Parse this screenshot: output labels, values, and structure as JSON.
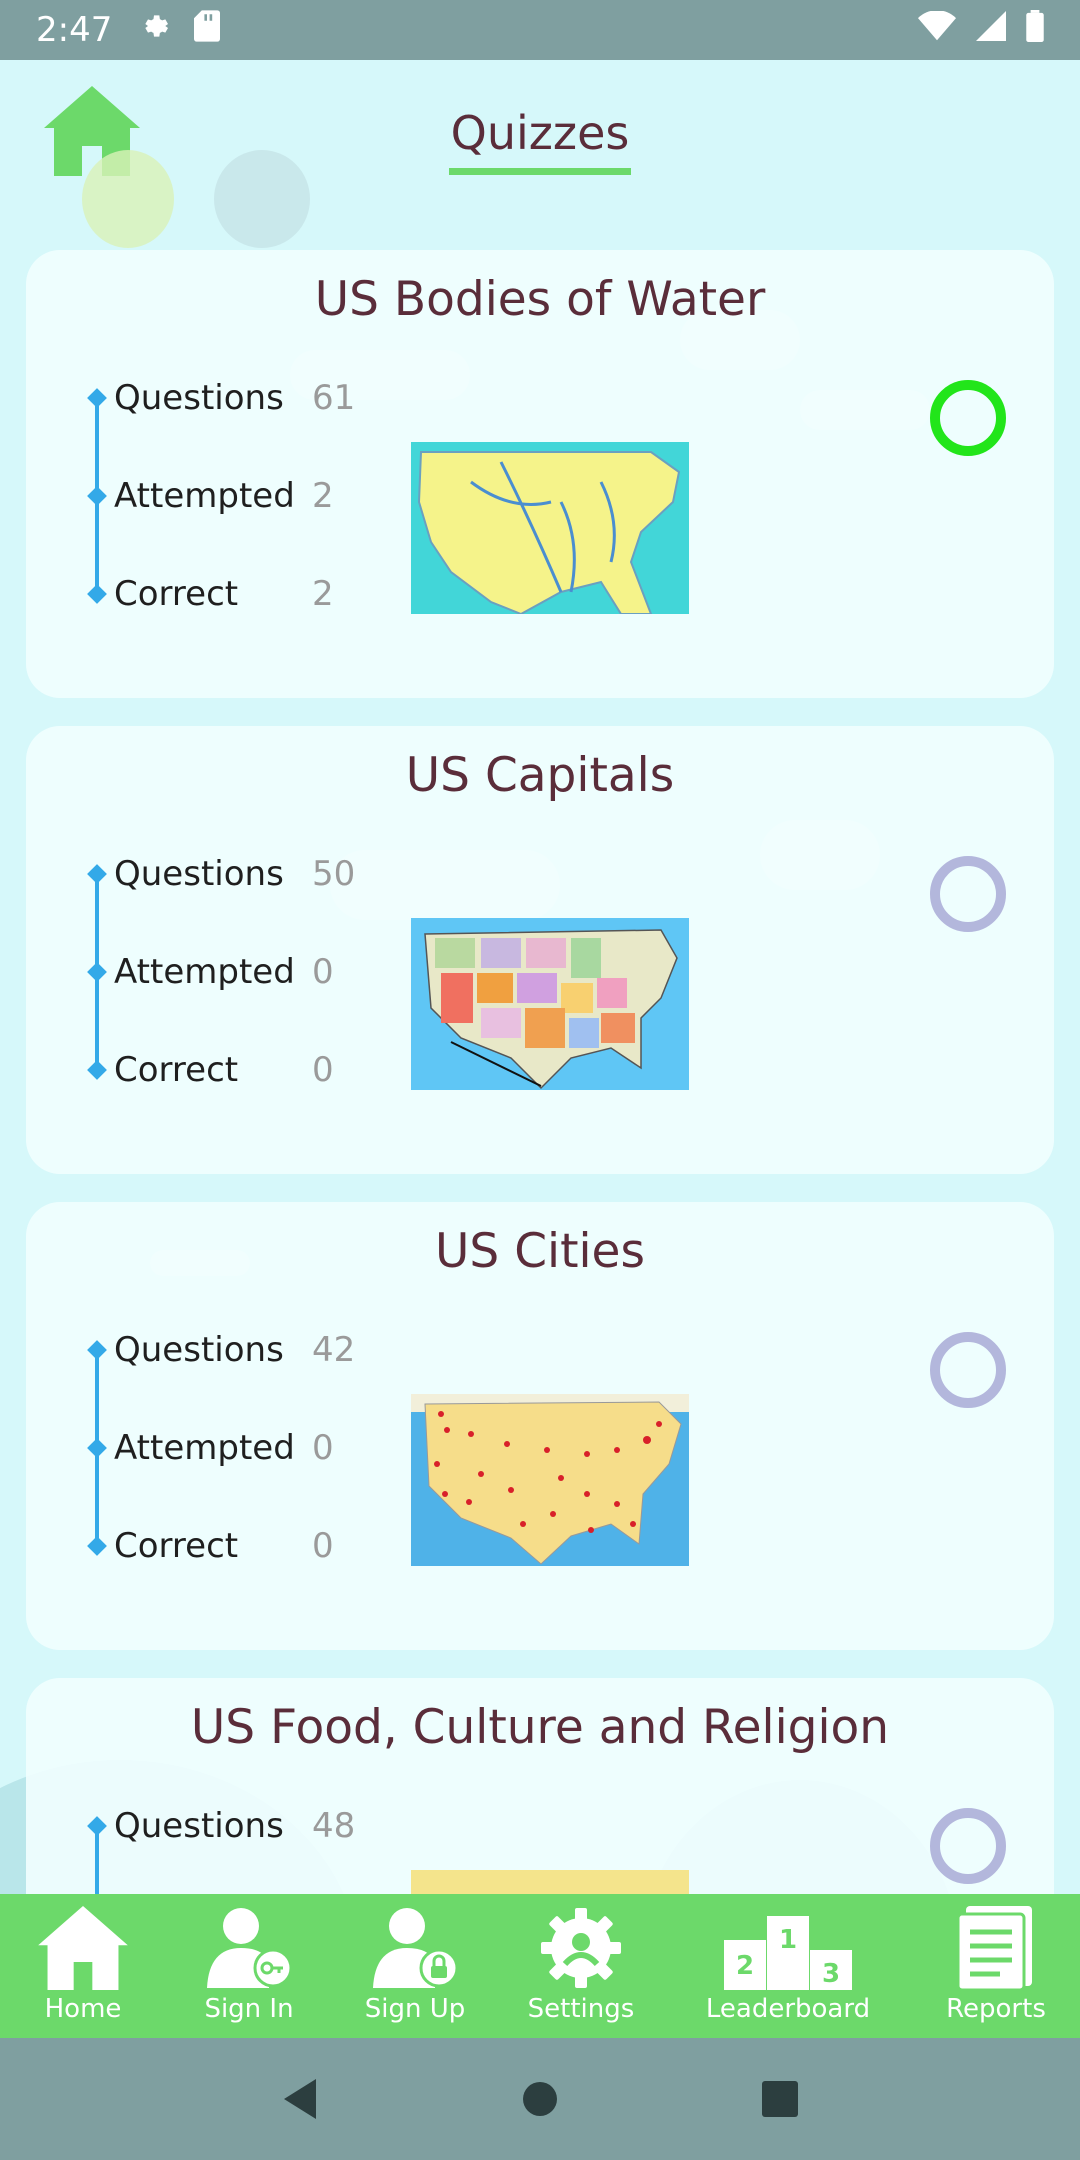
{
  "status_bar": {
    "time": "2:47",
    "icons": [
      "settings-icon",
      "sd-card-icon",
      "wifi-icon",
      "signal-icon",
      "battery-icon"
    ]
  },
  "header": {
    "title": "Quizzes",
    "home_icon": "home-icon"
  },
  "quizzes": [
    {
      "title": "US Bodies of Water",
      "questions_label": "Questions",
      "questions": "61",
      "attempted_label": "Attempted",
      "attempted": "2",
      "correct_label": "Correct",
      "correct": "2",
      "selected": true,
      "map_icon": "us-rivers-map-image"
    },
    {
      "title": "US Capitals",
      "questions_label": "Questions",
      "questions": "50",
      "attempted_label": "Attempted",
      "attempted": "0",
      "correct_label": "Correct",
      "correct": "0",
      "selected": false,
      "map_icon": "us-states-map-image"
    },
    {
      "title": "US Cities",
      "questions_label": "Questions",
      "questions": "42",
      "attempted_label": "Attempted",
      "attempted": "0",
      "correct_label": "Correct",
      "correct": "0",
      "selected": false,
      "map_icon": "us-cities-map-image"
    },
    {
      "title": "US Food, Culture and Religion",
      "questions_label": "Questions",
      "questions": "48",
      "selected": false,
      "map_icon": "us-food-map-image"
    }
  ],
  "bottom_nav": {
    "items": [
      {
        "label": "Home",
        "icon": "home-icon"
      },
      {
        "label": "Sign In",
        "icon": "sign-in-icon"
      },
      {
        "label": "Sign Up",
        "icon": "sign-up-icon"
      },
      {
        "label": "Settings",
        "icon": "settings-icon"
      },
      {
        "label": "Leaderboard",
        "icon": "leaderboard-icon"
      },
      {
        "label": "Reports",
        "icon": "reports-icon"
      }
    ]
  },
  "system_nav": {
    "icons": [
      "back-icon",
      "home-circle-icon",
      "recents-icon"
    ]
  },
  "colors": {
    "accent_green": "#6cd96a",
    "selected_ring": "#22e51a",
    "unselected_ring": "#b3b7dc",
    "title_color": "#5a2d3a",
    "stat_line": "#33a9e8"
  }
}
